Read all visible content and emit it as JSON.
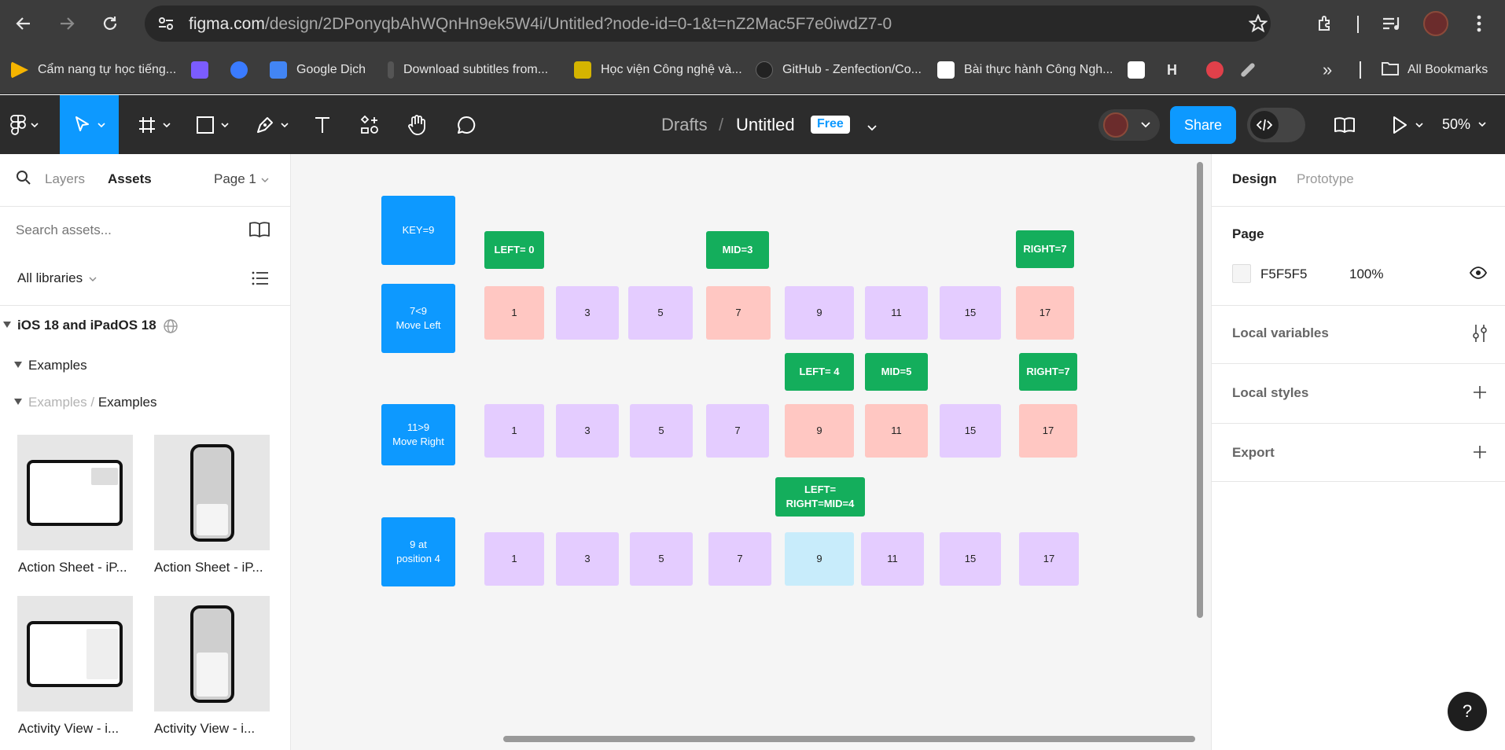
{
  "browser": {
    "url_host": "figma.com",
    "url_path": "/design/2DPonyqbAhWQnHn9ek5W4i/Untitled?node-id=0-1&t=nZ2Mac5F7e0iwdZ7-0",
    "bookmarks": [
      {
        "label": "Cẩm nang tự học tiếng...",
        "color": "#f5b400"
      },
      {
        "label": "",
        "color": "#7b5cff"
      },
      {
        "label": "",
        "color": "#3a7bff"
      },
      {
        "label": "Google Dịch",
        "color": "#4285f4"
      },
      {
        "label": "Download subtitles from...",
        "color": "#555555"
      },
      {
        "label": "Học viện Công nghệ và...",
        "color": "#d4b400"
      },
      {
        "label": "GitHub - Zenfection/Co...",
        "color": "#222222"
      },
      {
        "label": "Bài thực hành Công Ngh...",
        "color": "#ffffff"
      },
      {
        "label": "",
        "color": "#ffffff"
      },
      {
        "label": "H",
        "color": "#3c3c3c"
      },
      {
        "label": "",
        "color": "#e0404a"
      },
      {
        "label": "",
        "color": "#bbbbbb"
      }
    ],
    "all_bookmarks": "All Bookmarks"
  },
  "toolbar": {
    "breadcrumb_drafts": "Drafts",
    "breadcrumb_sep": "/",
    "file_name": "Untitled",
    "plan_badge": "Free",
    "share_label": "Share",
    "zoom": "50%"
  },
  "left_panel": {
    "tab_layers": "Layers",
    "tab_assets": "Assets",
    "page_selector": "Page 1",
    "search_placeholder": "Search assets...",
    "libraries": "All libraries",
    "library_name": "iOS 18 and iPadOS 18",
    "group_examples": "Examples",
    "breadcrumb_parent": "Examples",
    "breadcrumb_sep": "/",
    "breadcrumb_current": "Examples",
    "assets": [
      {
        "label": "Action Sheet - iP...",
        "device": "ipad"
      },
      {
        "label": "Action Sheet - iP...",
        "device": "iphone"
      },
      {
        "label": "Activity View - i...",
        "device": "ipad"
      },
      {
        "label": "Activity View - i...",
        "device": "iphone"
      }
    ]
  },
  "canvas": {
    "row_labels": [
      {
        "text1": "KEY=9",
        "text2": ""
      },
      {
        "text1": "7<9",
        "text2": "Move Left"
      },
      {
        "text1": "11>9",
        "text2": "Move Right"
      },
      {
        "text1": "9 at",
        "text2": "position 4"
      }
    ],
    "pointers": [
      {
        "text1": "LEFT= 0",
        "text2": ""
      },
      {
        "text1": "MID=3",
        "text2": ""
      },
      {
        "text1": "RIGHT=7",
        "text2": ""
      },
      {
        "text1": "LEFT= 4",
        "text2": ""
      },
      {
        "text1": "MID=5",
        "text2": ""
      },
      {
        "text1": "RIGHT=7",
        "text2": ""
      },
      {
        "text1": "LEFT=",
        "text2": "RIGHT=MID=4"
      }
    ],
    "rows": [
      {
        "values": [
          "1",
          "3",
          "5",
          "7",
          "9",
          "11",
          "15",
          "17"
        ],
        "colors": [
          "pink",
          "purple",
          "purple",
          "pink",
          "purple",
          "purple",
          "purple",
          "pink"
        ]
      },
      {
        "values": [
          "1",
          "3",
          "5",
          "7",
          "9",
          "11",
          "15",
          "17"
        ],
        "colors": [
          "purple",
          "purple",
          "purple",
          "purple",
          "pink",
          "pink",
          "purple",
          "pink"
        ]
      },
      {
        "values": [
          "1",
          "3",
          "5",
          "7",
          "9",
          "11",
          "15",
          "17"
        ],
        "colors": [
          "purple",
          "purple",
          "purple",
          "purple",
          "cyan",
          "purple",
          "purple",
          "purple"
        ]
      }
    ]
  },
  "right_panel": {
    "tab_design": "Design",
    "tab_prototype": "Prototype",
    "page_heading": "Page",
    "page_color": "F5F5F5",
    "page_opacity": "100%",
    "local_variables": "Local variables",
    "local_styles": "Local styles",
    "export": "Export"
  },
  "help_label": "?"
}
